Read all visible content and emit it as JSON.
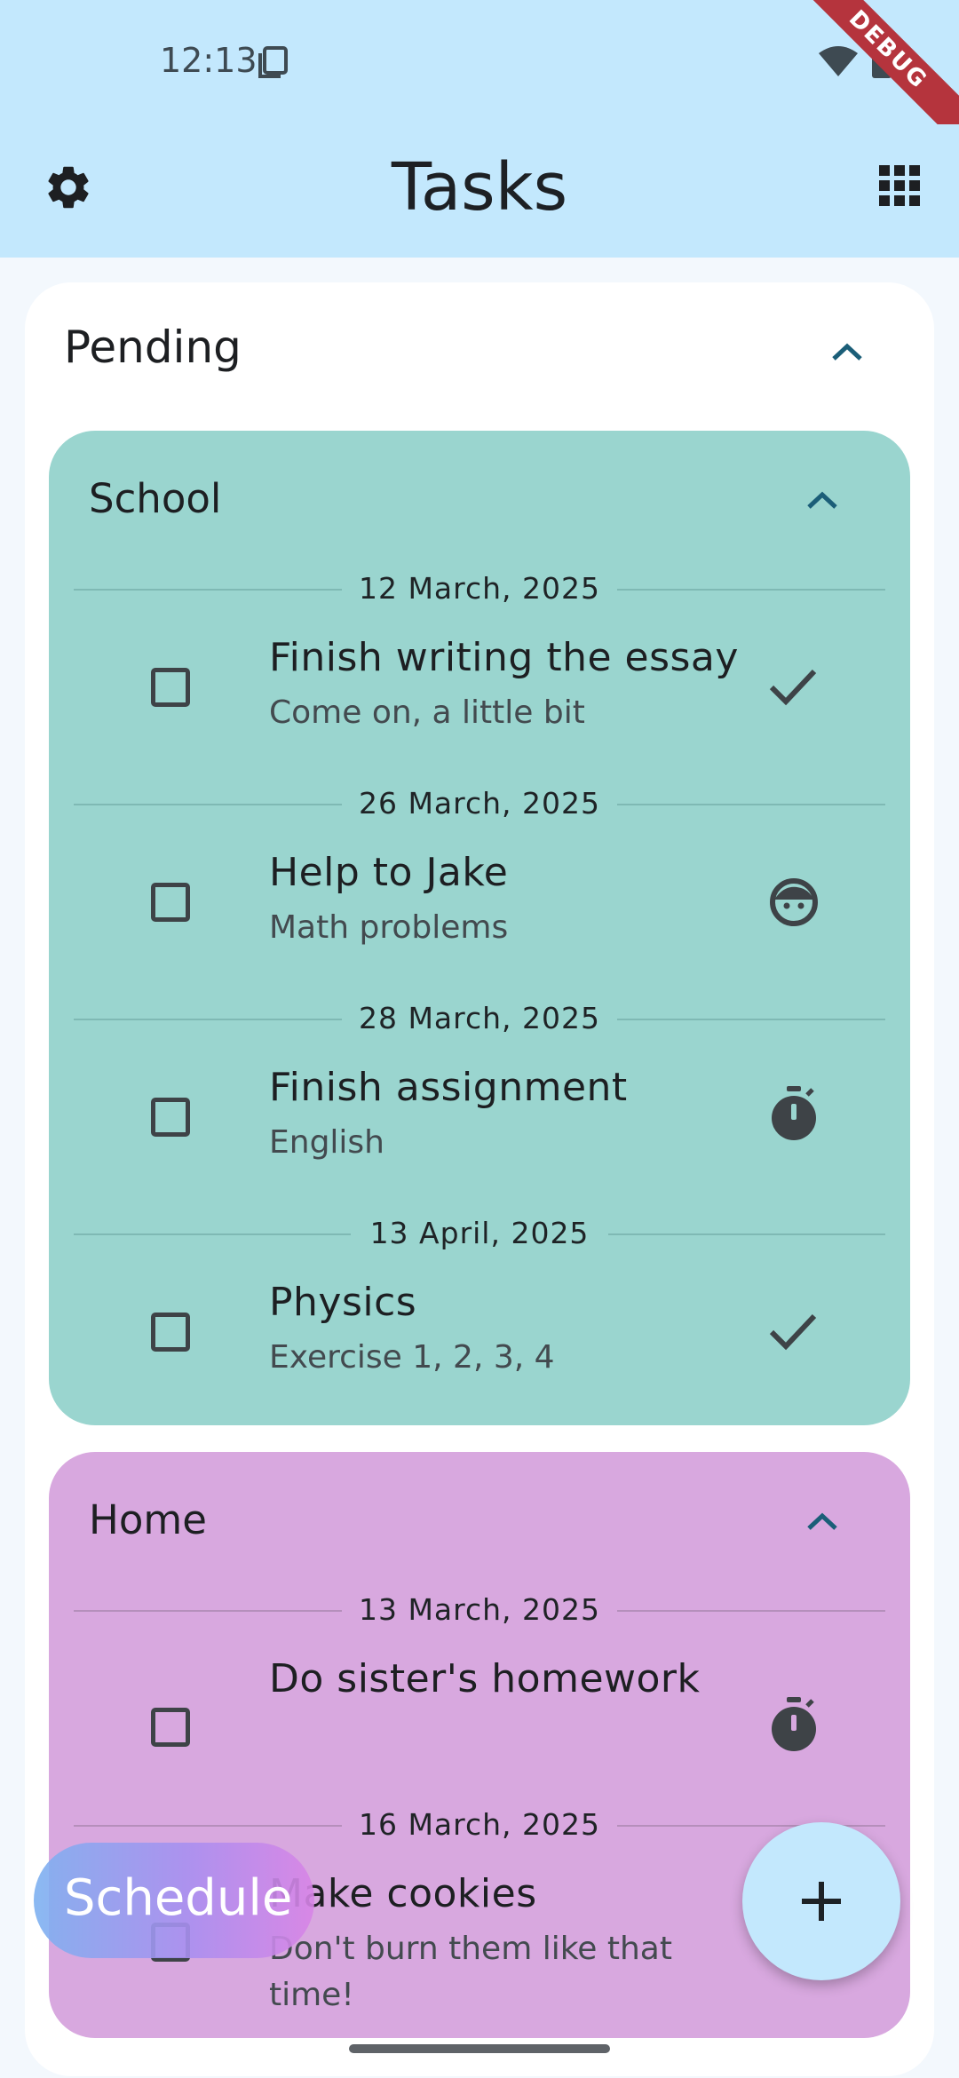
{
  "status_bar": {
    "time": "12:13",
    "debug_label": "DEBUG"
  },
  "app_bar": {
    "title": "Tasks",
    "left_icon": "settings-icon",
    "right_icon": "grid-icon"
  },
  "pending": {
    "title": "Pending",
    "groups": [
      {
        "name": "School",
        "color": "#9ad5cf",
        "tasks": [
          {
            "date": "12 March, 2025",
            "title": "Finish writing the essay",
            "subtitle": "Come on, a little bit",
            "icon": "check-icon"
          },
          {
            "date": "26 March, 2025",
            "title": "Help to Jake",
            "subtitle": "Math problems",
            "icon": "face-icon"
          },
          {
            "date": "28 March, 2025",
            "title": "Finish assignment",
            "subtitle": "English",
            "icon": "timer-icon"
          },
          {
            "date": "13 April, 2025",
            "title": "Physics",
            "subtitle": "Exercise 1, 2, 3, 4",
            "icon": "check-icon"
          }
        ]
      },
      {
        "name": "Home",
        "color": "#d8a8df",
        "tasks": [
          {
            "date": "13 March, 2025",
            "title": "Do sister's homework",
            "subtitle": "",
            "icon": "timer-icon"
          },
          {
            "date": "16 March, 2025",
            "title": "Make cookies",
            "subtitle": "Don't burn them like that time!",
            "icon": ""
          }
        ]
      }
    ]
  },
  "schedule_button": {
    "label": "Schedule"
  },
  "fab": {
    "icon": "add-icon"
  }
}
